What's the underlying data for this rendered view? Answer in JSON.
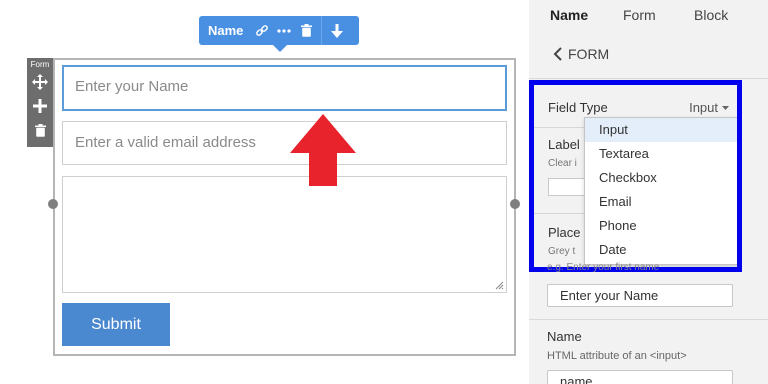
{
  "toolbar": {
    "name_label": "Name",
    "icons": [
      "link-icon",
      "more-icon",
      "trash-icon",
      "arrow-down-icon"
    ]
  },
  "side_handle": {
    "label": "Form",
    "icons": [
      "move-icon",
      "plus-icon",
      "trash-icon"
    ]
  },
  "form": {
    "name_placeholder": "Enter your Name",
    "email_placeholder": "Enter a valid email address",
    "message_value": "",
    "submit_label": "Submit"
  },
  "annotation": {
    "arrow_color": "#e8232c",
    "highlight_color": "#0000ee"
  },
  "panel": {
    "tabs": [
      "Name",
      "Form",
      "Block"
    ],
    "active_tab": "Name",
    "back_label": "FORM",
    "field_type": {
      "label": "Field Type",
      "value": "Input",
      "options": [
        "Input",
        "Textarea",
        "Checkbox",
        "Email",
        "Phone",
        "Date"
      ],
      "highlighted_option": "Input"
    },
    "label_section": {
      "title": "Label",
      "hint": "Clear i"
    },
    "placeholder_section": {
      "title": "Place",
      "hint": "Grey t",
      "example": "e.g. Enter your first name",
      "value": "Enter your Name"
    },
    "name_section": {
      "title": "Name",
      "hint": "HTML attribute of an <input>",
      "value": "name"
    }
  },
  "colors": {
    "accent": "#4a90e2",
    "submit": "#4a88cf",
    "selected_border": "#5a9bd8",
    "panel_bg": "#f2f2f2"
  }
}
